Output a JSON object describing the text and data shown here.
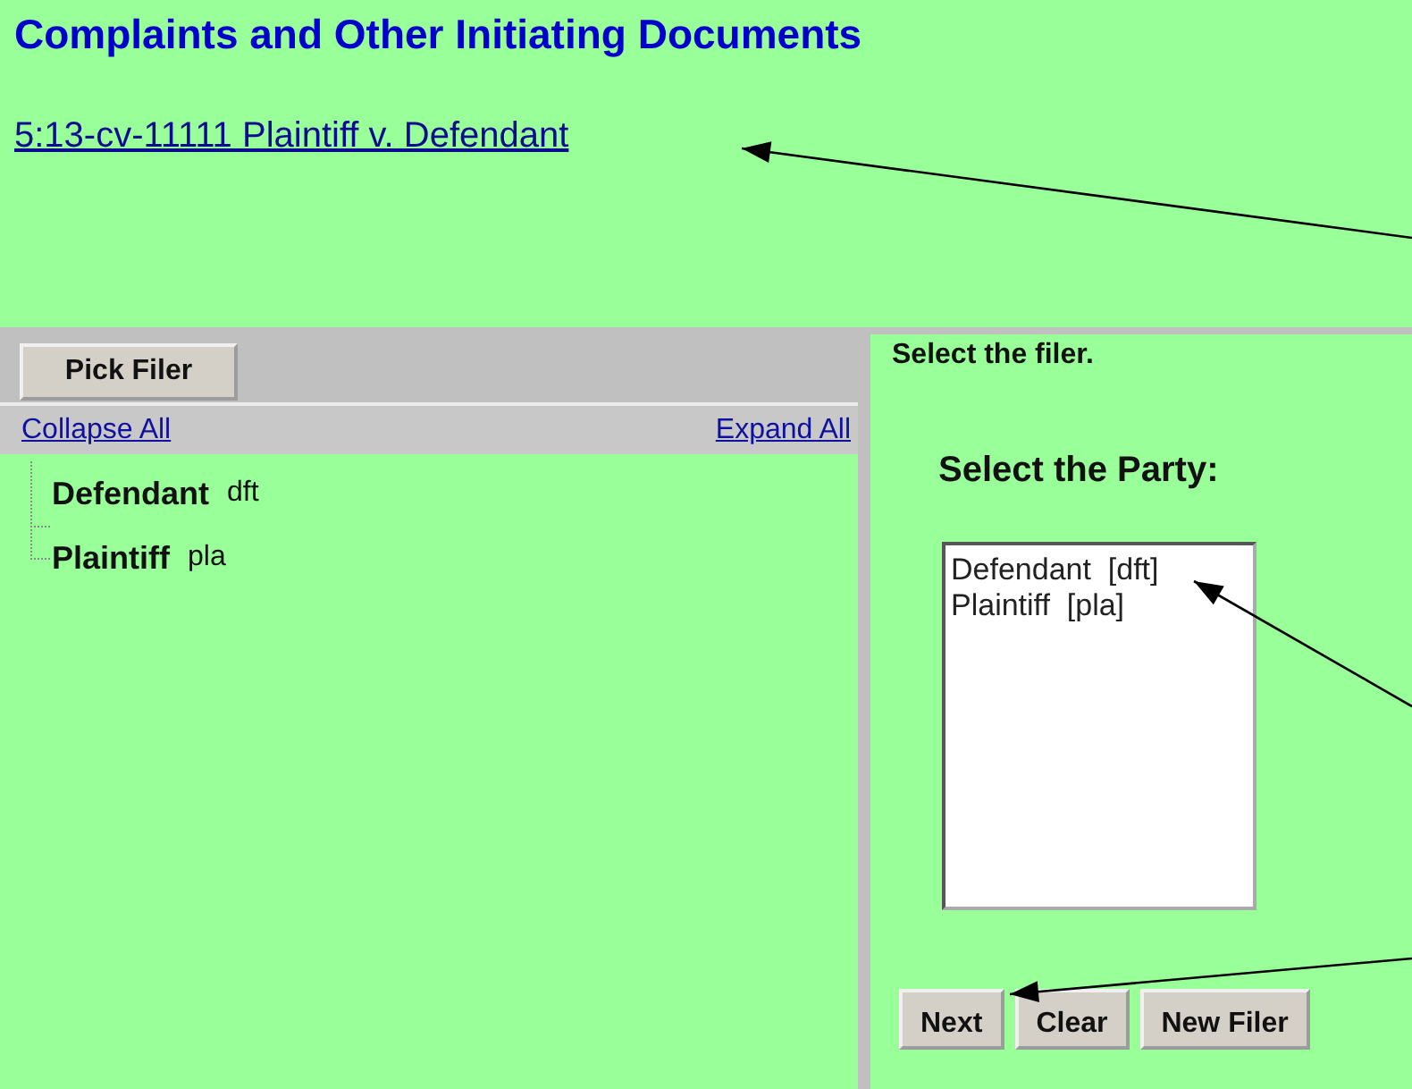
{
  "page_title": "Complaints and Other Initiating Documents",
  "case_link": "5:13-cv-11111 Plaintiff v. Defendant",
  "left_panel": {
    "pick_button": "Pick Filer",
    "collapse_link": "Collapse All",
    "expand_link": "Expand All",
    "tree": [
      {
        "name": "Defendant",
        "role": "dft"
      },
      {
        "name": "Plaintiff",
        "role": "pla"
      }
    ]
  },
  "right_panel": {
    "instruction": "Select the filer.",
    "party_heading": "Select the Party:",
    "party_options": [
      {
        "label": "Defendant  [dft]",
        "selected": false
      },
      {
        "label": "Plaintiff  [pla]",
        "selected": false
      }
    ],
    "buttons": [
      "Next",
      "Clear",
      "New Filer"
    ]
  },
  "annotations": [
    {
      "kind": "arrow"
    },
    {
      "kind": "arrow"
    },
    {
      "kind": "arrow"
    }
  ]
}
